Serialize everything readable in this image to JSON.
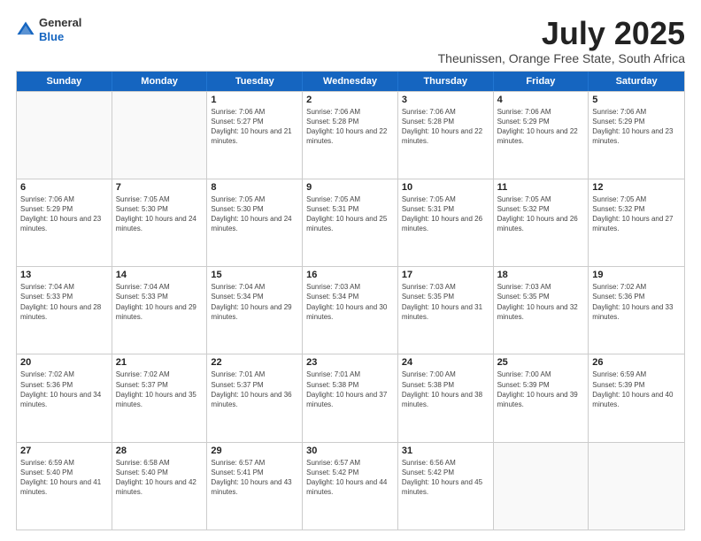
{
  "logo": {
    "general": "General",
    "blue": "Blue"
  },
  "title": "July 2025",
  "location": "Theunissen, Orange Free State, South Africa",
  "days_of_week": [
    "Sunday",
    "Monday",
    "Tuesday",
    "Wednesday",
    "Thursday",
    "Friday",
    "Saturday"
  ],
  "weeks": [
    [
      {
        "day": "",
        "empty": true
      },
      {
        "day": "",
        "empty": true
      },
      {
        "day": "1",
        "sunrise": "Sunrise: 7:06 AM",
        "sunset": "Sunset: 5:27 PM",
        "daylight": "Daylight: 10 hours and 21 minutes."
      },
      {
        "day": "2",
        "sunrise": "Sunrise: 7:06 AM",
        "sunset": "Sunset: 5:28 PM",
        "daylight": "Daylight: 10 hours and 22 minutes."
      },
      {
        "day": "3",
        "sunrise": "Sunrise: 7:06 AM",
        "sunset": "Sunset: 5:28 PM",
        "daylight": "Daylight: 10 hours and 22 minutes."
      },
      {
        "day": "4",
        "sunrise": "Sunrise: 7:06 AM",
        "sunset": "Sunset: 5:29 PM",
        "daylight": "Daylight: 10 hours and 22 minutes."
      },
      {
        "day": "5",
        "sunrise": "Sunrise: 7:06 AM",
        "sunset": "Sunset: 5:29 PM",
        "daylight": "Daylight: 10 hours and 23 minutes."
      }
    ],
    [
      {
        "day": "6",
        "sunrise": "Sunrise: 7:06 AM",
        "sunset": "Sunset: 5:29 PM",
        "daylight": "Daylight: 10 hours and 23 minutes."
      },
      {
        "day": "7",
        "sunrise": "Sunrise: 7:05 AM",
        "sunset": "Sunset: 5:30 PM",
        "daylight": "Daylight: 10 hours and 24 minutes."
      },
      {
        "day": "8",
        "sunrise": "Sunrise: 7:05 AM",
        "sunset": "Sunset: 5:30 PM",
        "daylight": "Daylight: 10 hours and 24 minutes."
      },
      {
        "day": "9",
        "sunrise": "Sunrise: 7:05 AM",
        "sunset": "Sunset: 5:31 PM",
        "daylight": "Daylight: 10 hours and 25 minutes."
      },
      {
        "day": "10",
        "sunrise": "Sunrise: 7:05 AM",
        "sunset": "Sunset: 5:31 PM",
        "daylight": "Daylight: 10 hours and 26 minutes."
      },
      {
        "day": "11",
        "sunrise": "Sunrise: 7:05 AM",
        "sunset": "Sunset: 5:32 PM",
        "daylight": "Daylight: 10 hours and 26 minutes."
      },
      {
        "day": "12",
        "sunrise": "Sunrise: 7:05 AM",
        "sunset": "Sunset: 5:32 PM",
        "daylight": "Daylight: 10 hours and 27 minutes."
      }
    ],
    [
      {
        "day": "13",
        "sunrise": "Sunrise: 7:04 AM",
        "sunset": "Sunset: 5:33 PM",
        "daylight": "Daylight: 10 hours and 28 minutes."
      },
      {
        "day": "14",
        "sunrise": "Sunrise: 7:04 AM",
        "sunset": "Sunset: 5:33 PM",
        "daylight": "Daylight: 10 hours and 29 minutes."
      },
      {
        "day": "15",
        "sunrise": "Sunrise: 7:04 AM",
        "sunset": "Sunset: 5:34 PM",
        "daylight": "Daylight: 10 hours and 29 minutes."
      },
      {
        "day": "16",
        "sunrise": "Sunrise: 7:03 AM",
        "sunset": "Sunset: 5:34 PM",
        "daylight": "Daylight: 10 hours and 30 minutes."
      },
      {
        "day": "17",
        "sunrise": "Sunrise: 7:03 AM",
        "sunset": "Sunset: 5:35 PM",
        "daylight": "Daylight: 10 hours and 31 minutes."
      },
      {
        "day": "18",
        "sunrise": "Sunrise: 7:03 AM",
        "sunset": "Sunset: 5:35 PM",
        "daylight": "Daylight: 10 hours and 32 minutes."
      },
      {
        "day": "19",
        "sunrise": "Sunrise: 7:02 AM",
        "sunset": "Sunset: 5:36 PM",
        "daylight": "Daylight: 10 hours and 33 minutes."
      }
    ],
    [
      {
        "day": "20",
        "sunrise": "Sunrise: 7:02 AM",
        "sunset": "Sunset: 5:36 PM",
        "daylight": "Daylight: 10 hours and 34 minutes."
      },
      {
        "day": "21",
        "sunrise": "Sunrise: 7:02 AM",
        "sunset": "Sunset: 5:37 PM",
        "daylight": "Daylight: 10 hours and 35 minutes."
      },
      {
        "day": "22",
        "sunrise": "Sunrise: 7:01 AM",
        "sunset": "Sunset: 5:37 PM",
        "daylight": "Daylight: 10 hours and 36 minutes."
      },
      {
        "day": "23",
        "sunrise": "Sunrise: 7:01 AM",
        "sunset": "Sunset: 5:38 PM",
        "daylight": "Daylight: 10 hours and 37 minutes."
      },
      {
        "day": "24",
        "sunrise": "Sunrise: 7:00 AM",
        "sunset": "Sunset: 5:38 PM",
        "daylight": "Daylight: 10 hours and 38 minutes."
      },
      {
        "day": "25",
        "sunrise": "Sunrise: 7:00 AM",
        "sunset": "Sunset: 5:39 PM",
        "daylight": "Daylight: 10 hours and 39 minutes."
      },
      {
        "day": "26",
        "sunrise": "Sunrise: 6:59 AM",
        "sunset": "Sunset: 5:39 PM",
        "daylight": "Daylight: 10 hours and 40 minutes."
      }
    ],
    [
      {
        "day": "27",
        "sunrise": "Sunrise: 6:59 AM",
        "sunset": "Sunset: 5:40 PM",
        "daylight": "Daylight: 10 hours and 41 minutes."
      },
      {
        "day": "28",
        "sunrise": "Sunrise: 6:58 AM",
        "sunset": "Sunset: 5:40 PM",
        "daylight": "Daylight: 10 hours and 42 minutes."
      },
      {
        "day": "29",
        "sunrise": "Sunrise: 6:57 AM",
        "sunset": "Sunset: 5:41 PM",
        "daylight": "Daylight: 10 hours and 43 minutes."
      },
      {
        "day": "30",
        "sunrise": "Sunrise: 6:57 AM",
        "sunset": "Sunset: 5:42 PM",
        "daylight": "Daylight: 10 hours and 44 minutes."
      },
      {
        "day": "31",
        "sunrise": "Sunrise: 6:56 AM",
        "sunset": "Sunset: 5:42 PM",
        "daylight": "Daylight: 10 hours and 45 minutes."
      },
      {
        "day": "",
        "empty": true
      },
      {
        "day": "",
        "empty": true
      }
    ]
  ]
}
